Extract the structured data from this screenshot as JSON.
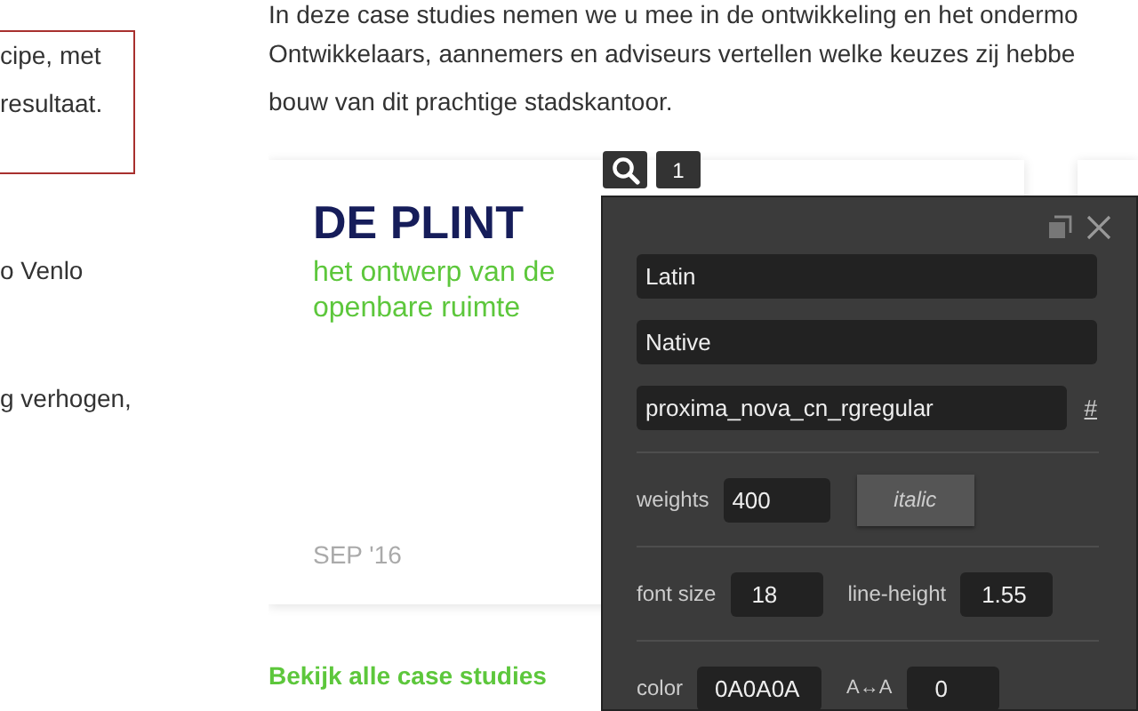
{
  "left_column": {
    "boxed_lines": [
      "cipe, met",
      "resultaat."
    ],
    "lines": [
      "o Venlo",
      "g verhogen,"
    ]
  },
  "intro": [
    "In deze case studies nemen we u mee in de ontwikkeling en het ondermo",
    "Ontwikkelaars, aannemers en adviseurs vertellen welke keuzes zij hebbe",
    "bouw van dit prachtige stadskantoor."
  ],
  "case_card": {
    "title": "DE PLINT",
    "subtitle": "het ontwerp van de openbare ruimte",
    "date": "SEP '16"
  },
  "all_link": "Bekijk alle case studies",
  "inspector_badge": "1",
  "font_panel": {
    "fields": [
      "Latin",
      "Native"
    ],
    "font_name": "proxima_nova_cn_rgregular",
    "hash_link": "#",
    "weights": {
      "label": "weights",
      "value": "400"
    },
    "italic_button": "italic",
    "font_size": {
      "label": "font size",
      "value": "18"
    },
    "line_height": {
      "label": "line-height",
      "value": "1.55"
    },
    "color": {
      "label": "color",
      "value": "0A0A0A"
    },
    "letter_spacing": {
      "label": "A↔A",
      "value": "0"
    }
  }
}
